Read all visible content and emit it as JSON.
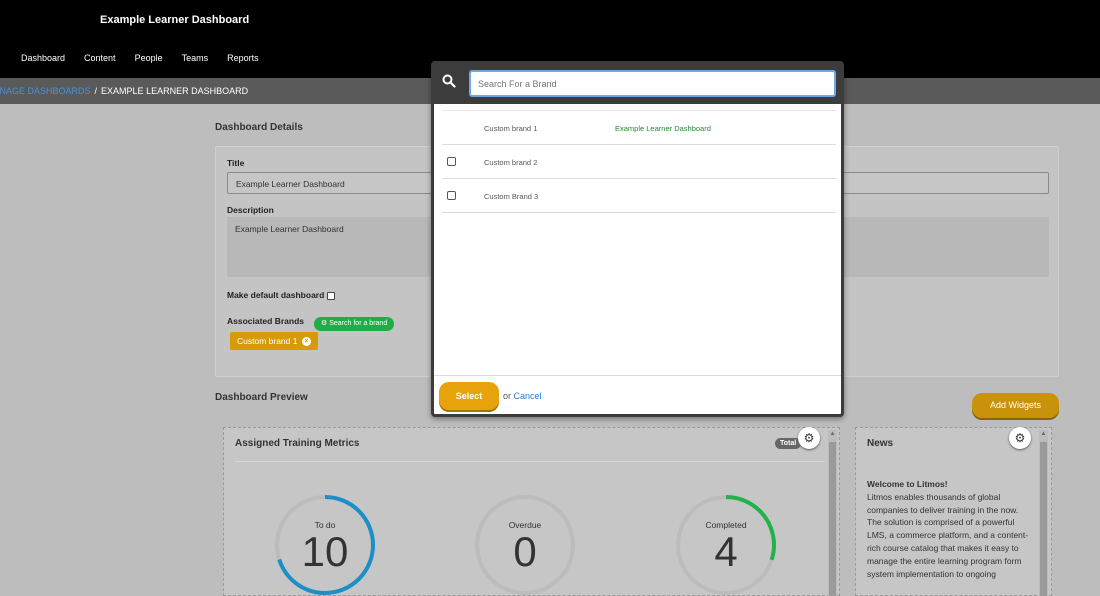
{
  "header": {
    "app_title": "Example Learner Dashboard",
    "nav": [
      "Dashboard",
      "Content",
      "People",
      "Teams",
      "Reports"
    ]
  },
  "breadcrumb": {
    "parent": "MANAGE DASHBOARDS",
    "separator": "/",
    "current": "EXAMPLE LEARNER DASHBOARD"
  },
  "details": {
    "section_title": "Dashboard Details",
    "title_label": "Title",
    "title_value": "Example Learner Dashboard",
    "description_label": "Description",
    "description_value": "Example Learner Dashboard",
    "default_label": "Make default dashboard",
    "brands_label": "Associated Brands",
    "search_brand_button": "Search for a brand",
    "brand_tag": "Custom brand 1"
  },
  "preview": {
    "section_title": "Dashboard Preview",
    "add_widgets": "Add Widgets",
    "metrics_widget": {
      "title": "Assigned Training Metrics",
      "badge": "Total",
      "gauges": [
        {
          "label": "To do",
          "value": "10",
          "fraction": 0.7,
          "color": "#1b8fc7"
        },
        {
          "label": "Overdue",
          "value": "0",
          "fraction": 0,
          "color": "#1b8fc7"
        },
        {
          "label": "Completed",
          "value": "4",
          "fraction": 0.3,
          "color": "#21b24b"
        }
      ]
    },
    "news_widget": {
      "title": "News",
      "headline": "Welcome to Litmos!",
      "body": "Litmos enables thousands of global companies to deliver training in the now. The solution is comprised of a powerful LMS, a commerce platform, and a content-rich course catalog that makes it easy to manage the entire learning program form system implementation to ongoing"
    }
  },
  "modal": {
    "search_placeholder": "Search For a Brand",
    "rows": [
      {
        "name": "Custom brand 1",
        "dashboard": "Example Learner Dashboard",
        "has_checkbox": false
      },
      {
        "name": "Custom brand 2",
        "dashboard": "",
        "has_checkbox": true
      },
      {
        "name": "Custom Brand 3",
        "dashboard": "",
        "has_checkbox": true
      }
    ],
    "select_label": "Select",
    "or_text": "or",
    "cancel_label": "Cancel"
  },
  "colors": {
    "accent_orange": "#e8a30c",
    "green": "#1fae45",
    "link_blue": "#2f7ad6"
  }
}
